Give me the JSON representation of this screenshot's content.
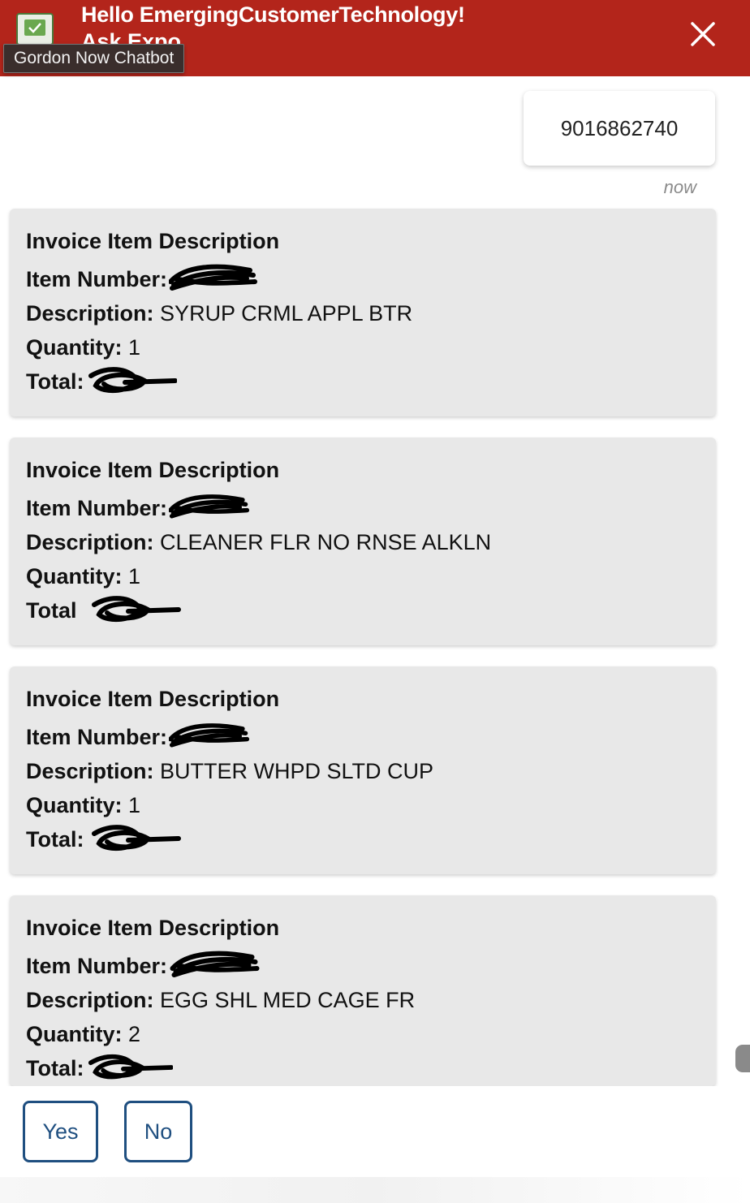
{
  "header": {
    "greeting": "Hello EmergingCustomerTechnology!",
    "subtitle": "Ask Expo",
    "tooltip": "Gordon Now Chatbot",
    "colors": {
      "background": "#b3251b",
      "text": "#ffffff"
    },
    "icons": {
      "app": "checkbox-icon",
      "close": "close-icon"
    }
  },
  "conversation": {
    "user_message": "9016862740",
    "timestamp": "now",
    "invoice_items": [
      {
        "title": "Invoice Item Description",
        "item_number_label": "Item Number:",
        "description_label": "Description:",
        "description": "SYRUP CRML APPL BTR",
        "quantity_label": "Quantity:",
        "quantity": "1",
        "total_label": "Total:"
      },
      {
        "title": "Invoice Item Description",
        "item_number_label": "Item Number:",
        "description_label": "Description:",
        "description": "CLEANER FLR NO RNSE ALKLN",
        "quantity_label": "Quantity:",
        "quantity": "1",
        "total_label": "Total"
      },
      {
        "title": "Invoice Item Description",
        "item_number_label": "Item Number:",
        "description_label": "Description:",
        "description": "BUTTER WHPD SLTD CUP",
        "quantity_label": "Quantity:",
        "quantity": "1",
        "total_label": "Total:"
      },
      {
        "title": "Invoice Item Description",
        "item_number_label": "Item Number:",
        "description_label": "Description:",
        "description": "EGG SHL MED CAGE FR",
        "quantity_label": "Quantity:",
        "quantity": "2",
        "total_label": "Total:"
      }
    ]
  },
  "quick_replies": {
    "yes": "Yes",
    "no": "No"
  },
  "colors": {
    "card_bg": "#e8e8e8",
    "button_border": "#1f4f80"
  }
}
